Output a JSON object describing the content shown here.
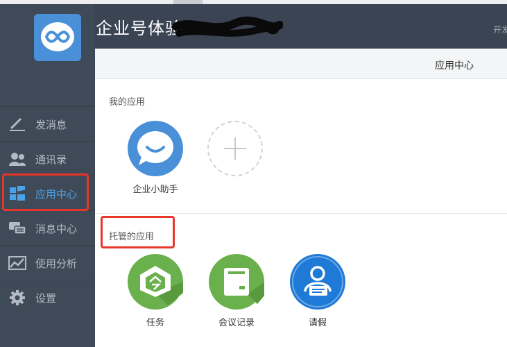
{
  "header": {
    "title": "企业号体验",
    "dev_link": "开发"
  },
  "sidebar": {
    "items": [
      {
        "label": "发消息",
        "icon": "pencil-icon"
      },
      {
        "label": "通讯录",
        "icon": "contacts-icon"
      },
      {
        "label": "应用中心",
        "icon": "app-grid-icon",
        "active": true
      },
      {
        "label": "消息中心",
        "icon": "chat-bubbles-icon"
      },
      {
        "label": "使用分析",
        "icon": "line-chart-icon"
      },
      {
        "label": "设置",
        "icon": "gear-icon"
      }
    ]
  },
  "panel": {
    "title": "应用中心",
    "my_apps_label": "我的应用",
    "my_apps": [
      {
        "name": "企业小助手",
        "icon": "smile-bubble-icon",
        "color": "#4a90d9"
      }
    ],
    "hosted_label": "托管的应用",
    "hosted_apps": [
      {
        "name": "任务",
        "icon": "task-icon",
        "color": "#6ab04c"
      },
      {
        "name": "会议记录",
        "icon": "meeting-notes-icon",
        "color": "#6ab04c"
      },
      {
        "name": "请假",
        "icon": "leave-request-icon",
        "color": "#1e7ad6"
      }
    ]
  },
  "colors": {
    "sidebar_bg": "#3f4a59",
    "active_text": "#4aa3e8",
    "highlight": "#e8362a"
  }
}
